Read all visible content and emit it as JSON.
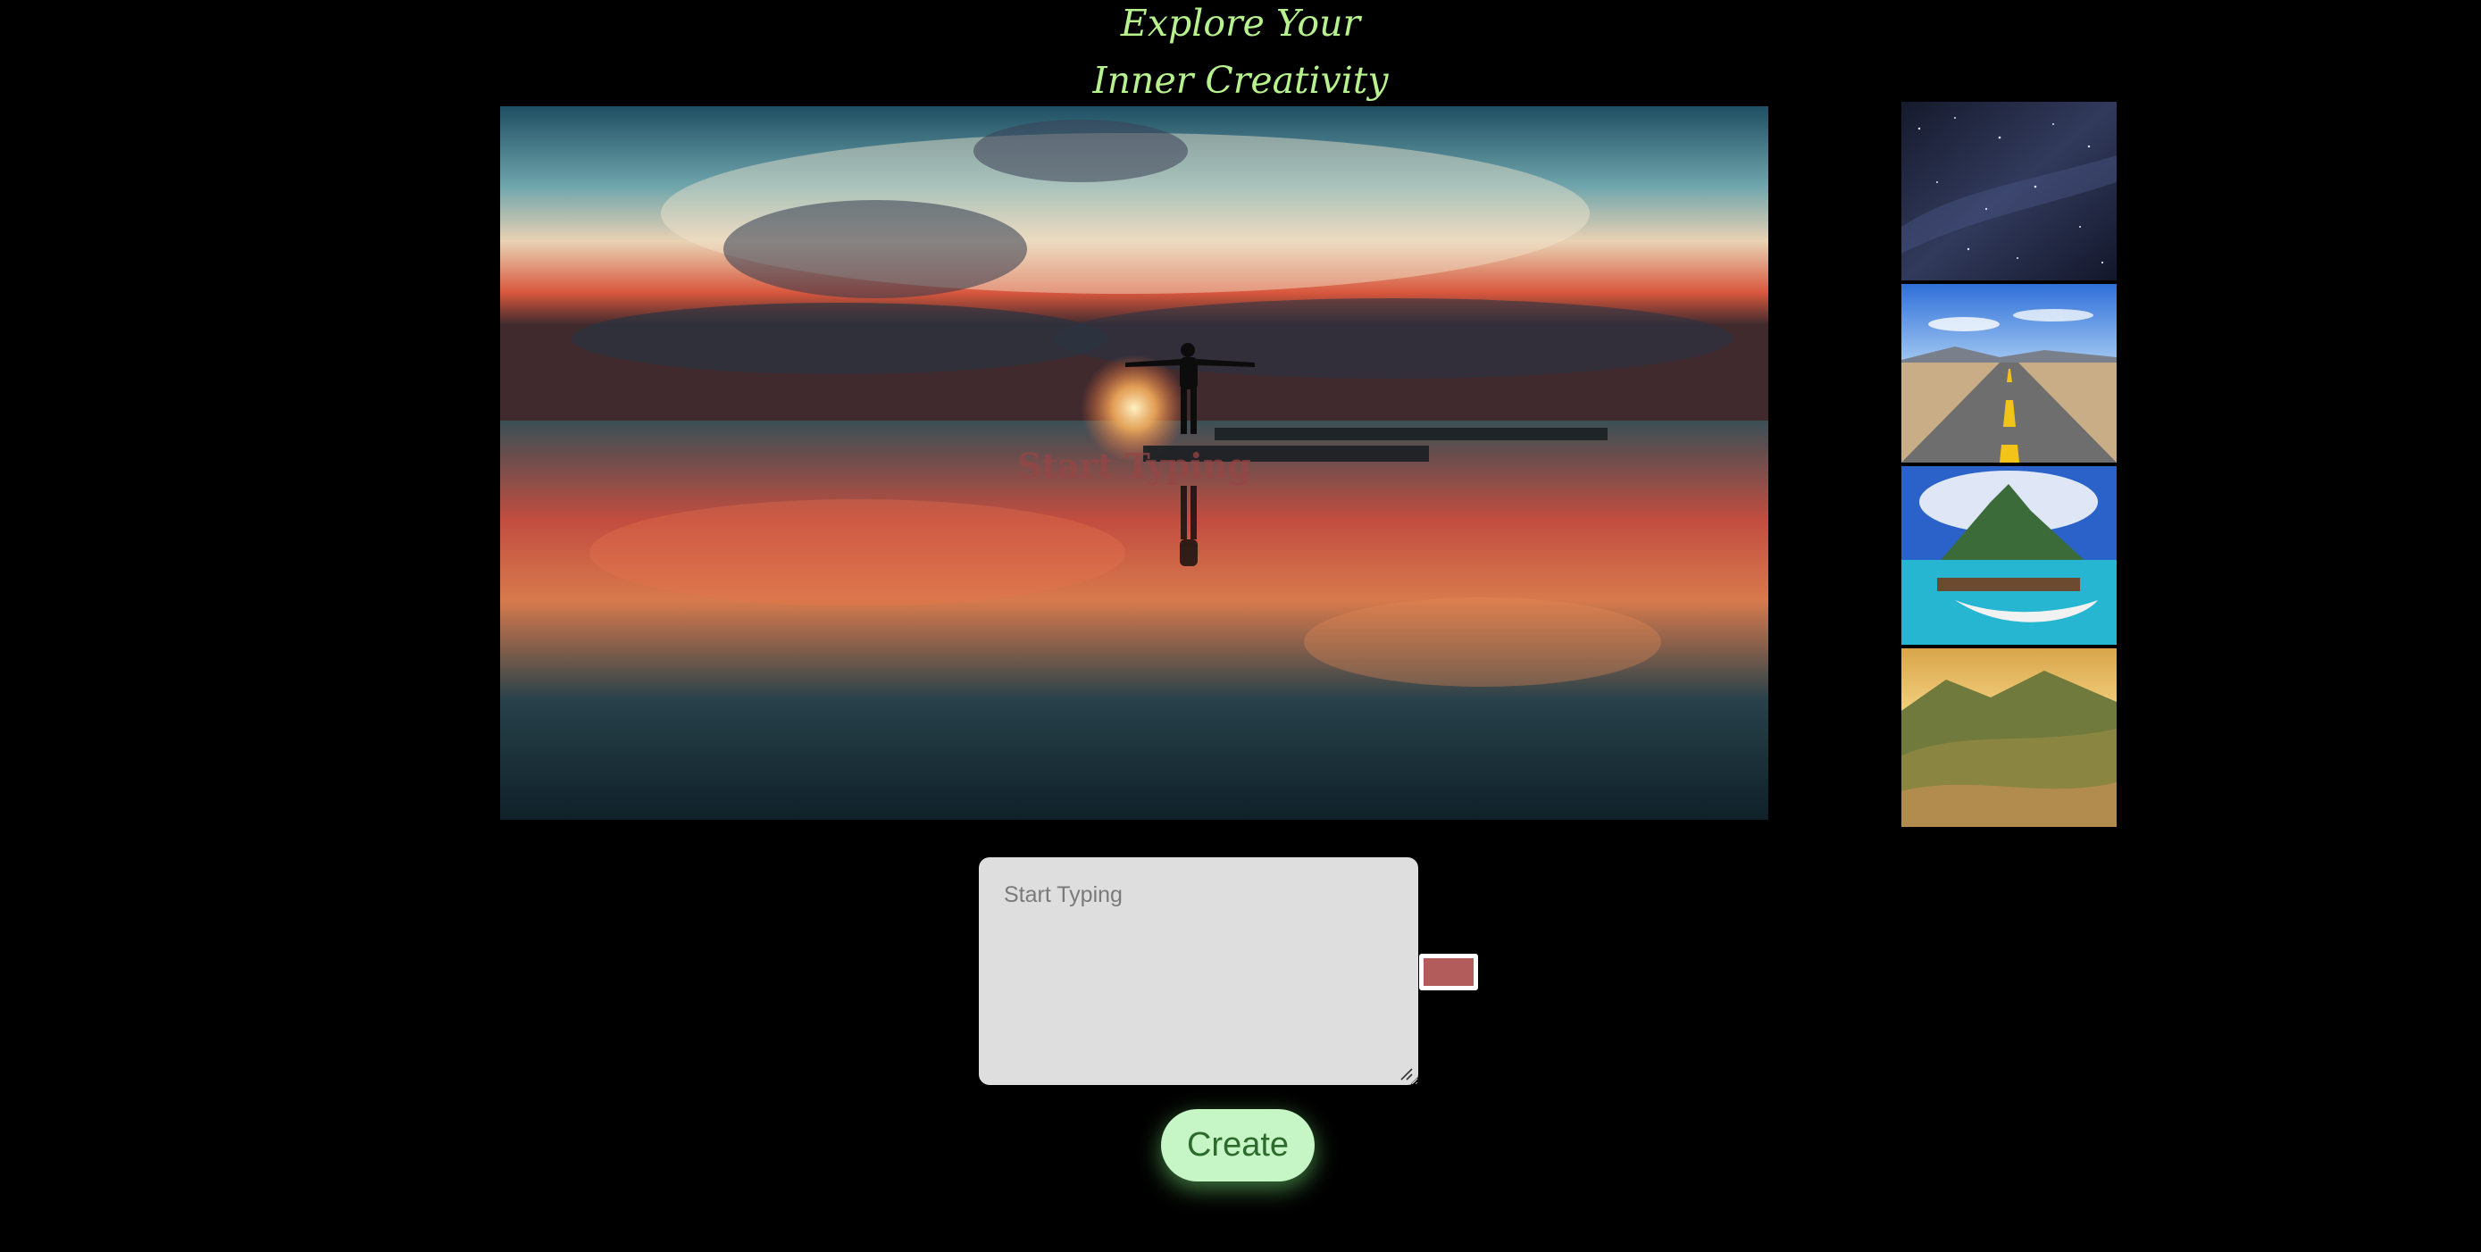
{
  "header": {
    "title_line1": "Explore Your",
    "title_line2": "Inner Creativity"
  },
  "preview": {
    "overlay_text": "Start Typing",
    "overlay_color": "#964646"
  },
  "thumbnails": [
    {
      "name": "starry-night-sky"
    },
    {
      "name": "desert-road"
    },
    {
      "name": "tropical-island"
    },
    {
      "name": "mountain-valley"
    }
  ],
  "editor": {
    "value": "",
    "placeholder": "Start Typing",
    "text_color": "#b35c5c"
  },
  "actions": {
    "create_label": "Create"
  },
  "colors": {
    "background": "#000000",
    "title": "#b7f28f",
    "button_bg": "#c6f5c6",
    "button_text": "#2d6b2d"
  }
}
